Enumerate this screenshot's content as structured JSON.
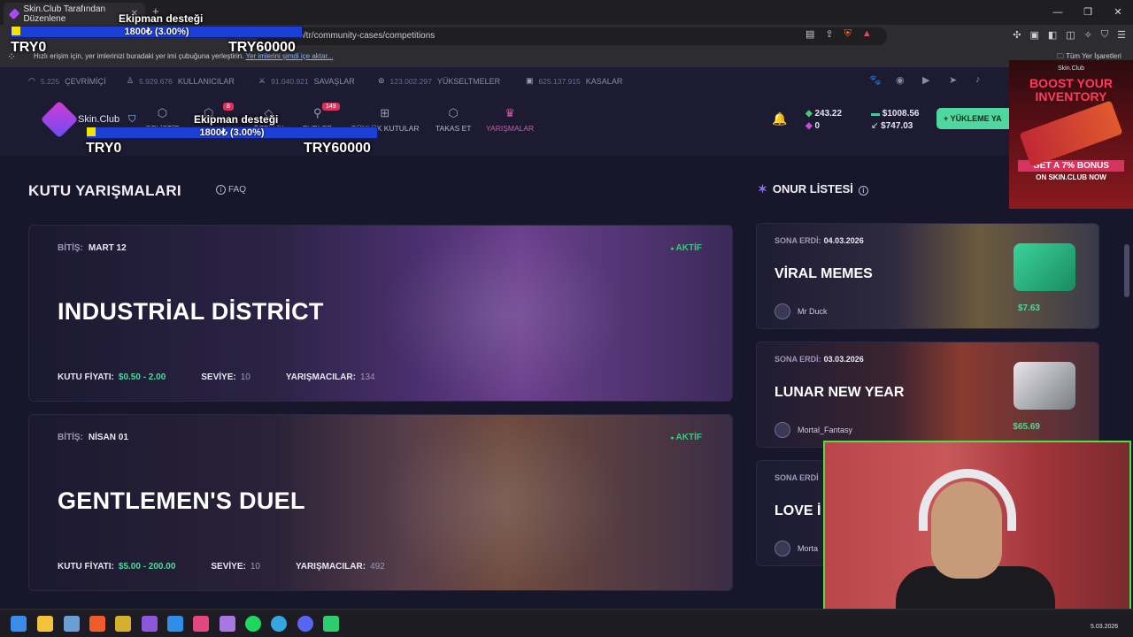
{
  "browser": {
    "tab_title": "Skin.Club Tarafından Düzenlene",
    "url": "skin.club/tr/community-cases/competitions",
    "bookmark_hint": "Hızlı erişim için, yer imlerinizi buradaki yer imi çubuğuna yerleştirin.",
    "bookmark_link": "Yer imlerini şimdi içe aktar...",
    "all_bookmarks": "Tüm Yer İşaretleri"
  },
  "overlay": {
    "title": "Ekipman desteği",
    "progress_text": "1800₺ (3.00%)",
    "progress_fraction": 0.03,
    "min": "TRY0",
    "max": "TRY60000"
  },
  "stats": [
    {
      "value": "5.225",
      "label": "ÇEVRİMİÇİ",
      "icon": "signal-icon"
    },
    {
      "value": "5.929.676",
      "label": "KULLANICILAR",
      "icon": "user-icon"
    },
    {
      "value": "91.040.921",
      "label": "SAVAŞLAR",
      "icon": "swords-icon"
    },
    {
      "value": "123.002.297",
      "label": "YÜKSELTMELER",
      "icon": "upgrade-icon"
    },
    {
      "value": "625.137.915",
      "label": "KASALAR",
      "icon": "case-icon"
    }
  ],
  "nav": {
    "brand": "Skin.Club",
    "items": [
      {
        "label": "GELİŞTİR",
        "badge": ""
      },
      {
        "label": "",
        "badge": "8"
      },
      {
        "label": "ÖZELLİK",
        "badge": ""
      },
      {
        "label": "PVPLER",
        "badge": "149"
      },
      {
        "label": "GÜNLÜK KUTULAR",
        "badge": ""
      },
      {
        "label": "TAKAS ET",
        "badge": ""
      },
      {
        "label": "YARIŞMALAR",
        "badge": ""
      }
    ],
    "coins_green": "243.22",
    "coins_purple": "0",
    "balance_main": "$1008.56",
    "balance_secondary": "$747.03",
    "deposit_label": "+ YÜKLEME YA"
  },
  "page": {
    "title": "KUTU YARIŞMALARI",
    "faq": "FAQ"
  },
  "competitions": [
    {
      "ends_label": "BİTİŞ:",
      "ends_value": "MART 12",
      "status": "AKTİF",
      "name": "INDUSTRİAL DİSTRİCT",
      "price_label": "KUTU FİYATI:",
      "price": "$0.50 - 2.00",
      "level_label": "SEVİYE:",
      "level": "10",
      "players_label": "YARIŞMACILAR:",
      "players": "134"
    },
    {
      "ends_label": "BİTİŞ:",
      "ends_value": "NİSAN 01",
      "status": "AKTİF",
      "name": "GENTLEMEN'S DUEL",
      "price_label": "KUTU FİYATI:",
      "price": "$5.00 - 200.00",
      "level_label": "SEVİYE:",
      "level": "10",
      "players_label": "YARIŞMACILAR:",
      "players": "492"
    }
  ],
  "honor": {
    "title": "ONUR LİSTESİ",
    "items": [
      {
        "ended_label": "SONA ERDİ:",
        "date": "04.03.2026",
        "name": "VİRAL MEMES",
        "winner": "Mr Duck",
        "prize": "$7.63"
      },
      {
        "ended_label": "SONA ERDİ:",
        "date": "03.03.2026",
        "name": "LUNAR NEW YEAR",
        "winner": "Mortal_Fantasy",
        "prize": "$65.69"
      },
      {
        "ended_label": "SONA ERDİ",
        "date": "",
        "name": "LOVE İ",
        "winner": "Morta",
        "prize": ""
      }
    ]
  },
  "ad": {
    "brand": "Skin.Club",
    "headline": "BOOST YOUR INVENTORY",
    "cta": "GET A 7% BONUS",
    "sub": "ON SKIN.CLUB NOW"
  },
  "webcam": {
    "date": "5.03.2026"
  },
  "taskbar": {
    "date": "5.03.2026"
  }
}
